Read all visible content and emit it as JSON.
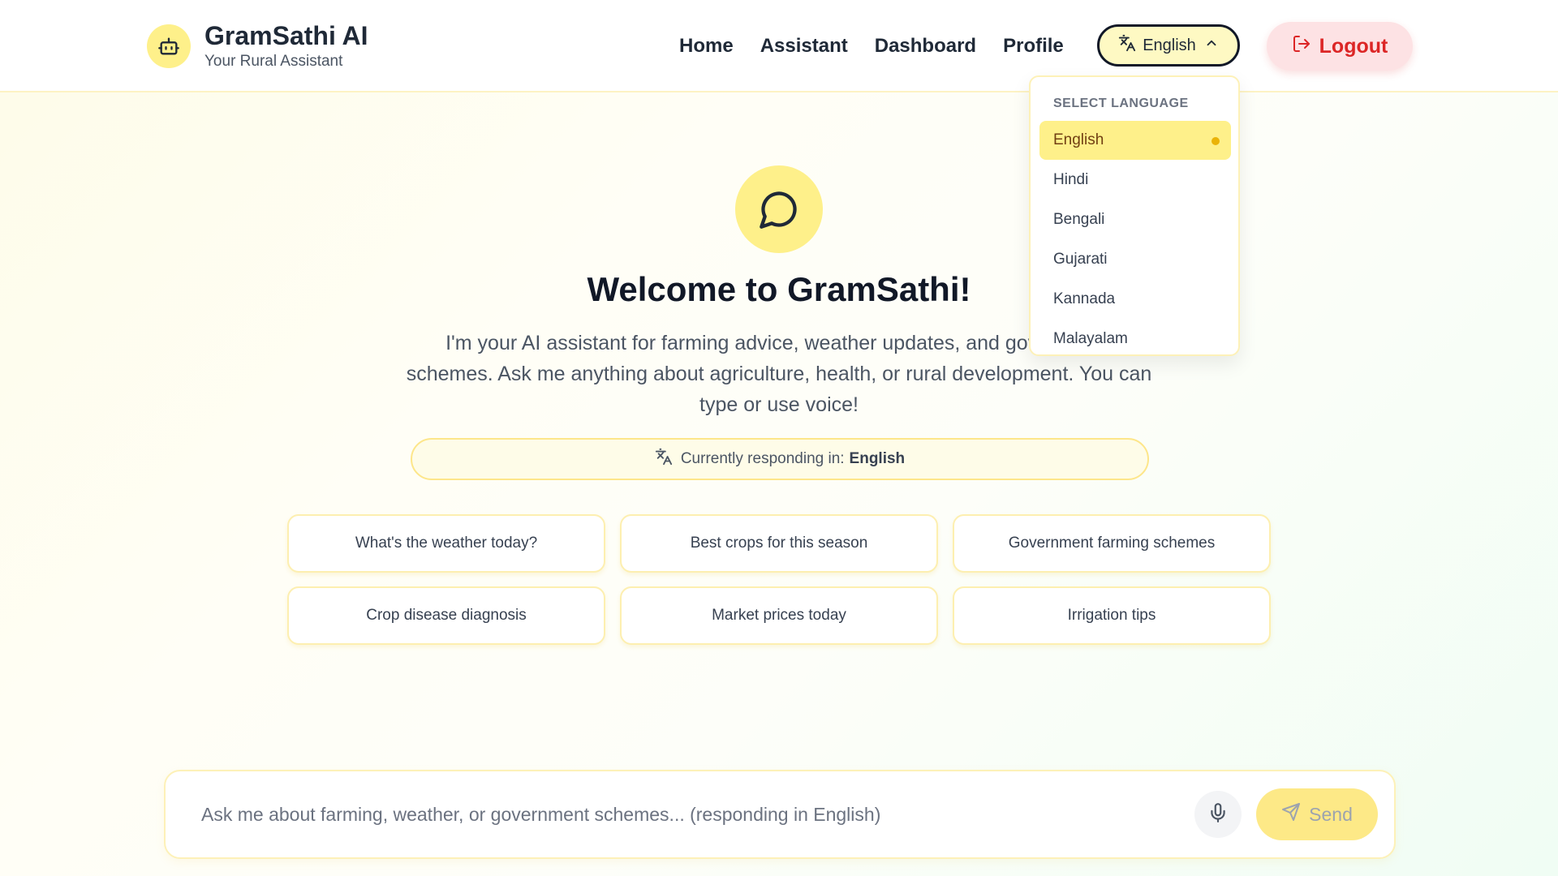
{
  "brand": {
    "title": "GramSathi AI",
    "subtitle": "Your Rural Assistant",
    "logo_icon": "robot-icon"
  },
  "nav": {
    "items": [
      "Home",
      "Assistant",
      "Dashboard",
      "Profile"
    ]
  },
  "language_button": {
    "label": "English",
    "icon": "translate-icon",
    "chevron": "chevron-up-icon"
  },
  "logout": {
    "label": "Logout",
    "icon": "logout-icon",
    "color": "#dc2626"
  },
  "language_dropdown": {
    "title": "SELECT LANGUAGE",
    "selected": "English",
    "options": [
      "English",
      "Hindi",
      "Bengali",
      "Gujarati",
      "Kannada",
      "Malayalam"
    ]
  },
  "welcome": {
    "icon": "chat-bubble-icon",
    "title": "Welcome to GramSathi!",
    "text": "I'm your AI assistant for farming advice, weather updates, and government schemes. Ask me anything about agriculture, health, or rural development. You can type or use voice!",
    "responding_label": "Currently responding in:",
    "responding_language": "English"
  },
  "suggestions": [
    "What's the weather today?",
    "Best crops for this season",
    "Government farming schemes",
    "Crop disease diagnosis",
    "Market prices today",
    "Irrigation tips"
  ],
  "chat": {
    "placeholder": "Ask me about farming, weather, or government schemes... (responding in English)",
    "value": "",
    "mic_icon": "microphone-icon",
    "send_label": "Send",
    "send_icon": "send-icon"
  },
  "colors": {
    "accent": "#fef08a",
    "accent_border": "#fde68a",
    "danger": "#dc2626",
    "selected_dot": "#eab308"
  }
}
